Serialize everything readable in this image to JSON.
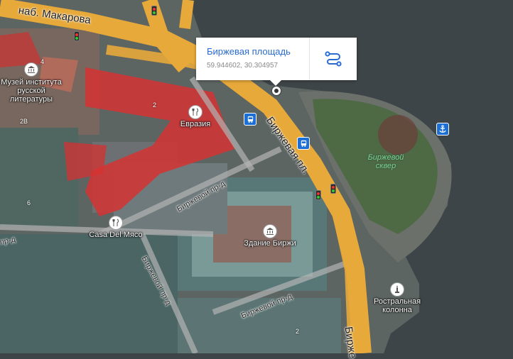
{
  "popup": {
    "title": "Биржевая площадь",
    "coords": "59.944602, 30.304957"
  },
  "streets": {
    "makarova": "наб. Макарова",
    "birzhevaya_pl": "Биржевая пл.",
    "birzhevaya_pl_bottom": "Бирже",
    "birzhevoy_1": "Биржевой пр-д",
    "birzhevoy_2": "Биржевой пр-д",
    "birzhevoy_3": "Биржевой пр-д",
    "pr_d_left": "пр-д"
  },
  "places": {
    "museum": "Музей института\nрусской\nлитературы",
    "evraziya": "Евразия",
    "casa": "Casa Del Мясо",
    "birzha": "Здание Биржи",
    "kolonna": "Ростральная\nколонна",
    "park": "Биржевой\nсквер"
  },
  "house_numbers": {
    "n4": "4",
    "n2a": "2",
    "n2b": "2В",
    "n6": "6",
    "n2c": "2"
  },
  "icons": {
    "museum": "museum-icon",
    "restaurant": "restaurant-icon",
    "monument": "monument-icon",
    "bus": "bus-stop-icon",
    "anchor": "pier-anchor-icon",
    "route": "route-icon",
    "traffic": "traffic-light-icon"
  },
  "colors": {
    "road": "#e7a93a",
    "accent": "#2a6bd1",
    "highlight": "#e02020",
    "water": "#3e4548"
  }
}
